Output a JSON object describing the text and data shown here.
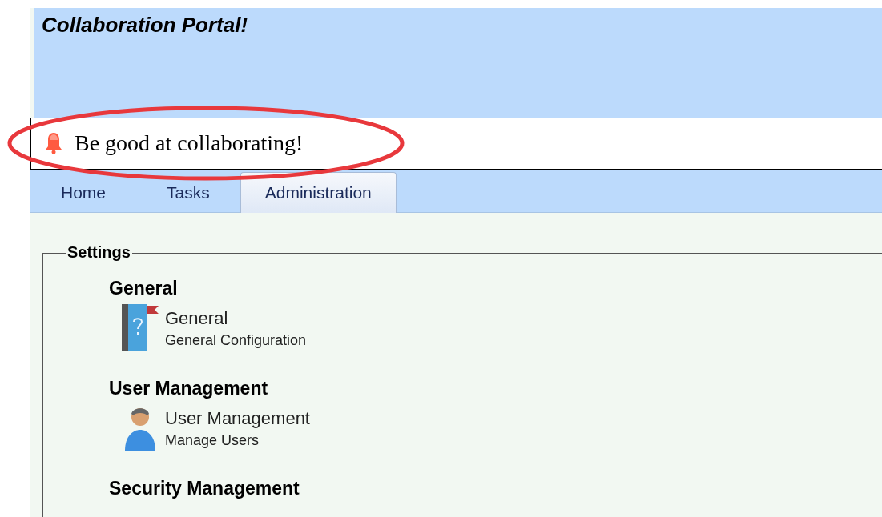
{
  "header": {
    "title": "Collaboration Portal!"
  },
  "notice": {
    "text": "Be good at collaborating!"
  },
  "tabs": [
    {
      "label": "Home",
      "selected": false
    },
    {
      "label": "Tasks",
      "selected": false
    },
    {
      "label": "Administration",
      "selected": true
    }
  ],
  "settings": {
    "legend": "Settings",
    "sections": [
      {
        "title": "General",
        "items": [
          {
            "kind": "help-book",
            "name": "General",
            "description": "General Configuration"
          }
        ]
      },
      {
        "title": "User Management",
        "items": [
          {
            "kind": "user",
            "name": "User Management",
            "description": "Manage Users"
          }
        ]
      },
      {
        "title": "Security Management"
      }
    ]
  }
}
